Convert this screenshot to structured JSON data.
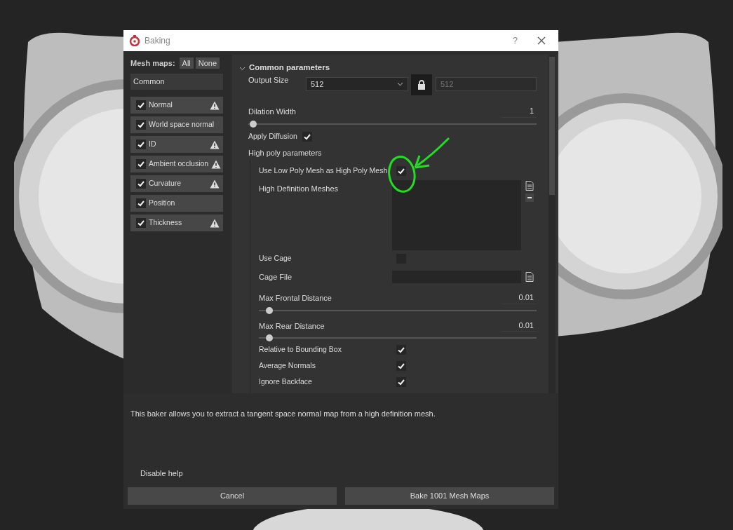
{
  "window": {
    "title": "Baking",
    "help": "?"
  },
  "mesh_maps": {
    "label": "Mesh maps:",
    "buttons": [
      "All",
      "None"
    ],
    "group": "Common",
    "items": [
      {
        "label": "Normal",
        "checked": true,
        "warning": true
      },
      {
        "label": "World space normal",
        "checked": true,
        "warning": false
      },
      {
        "label": "ID",
        "checked": true,
        "warning": true
      },
      {
        "label": "Ambient occlusion",
        "checked": true,
        "warning": true
      },
      {
        "label": "Curvature",
        "checked": true,
        "warning": true
      },
      {
        "label": "Position",
        "checked": true,
        "warning": false
      },
      {
        "label": "Thickness",
        "checked": true,
        "warning": true
      }
    ]
  },
  "section": {
    "title": "Common parameters",
    "expanded": true,
    "params": [
      {
        "kind": "size",
        "label": "Output Size",
        "value": "512",
        "locked": true,
        "linked_value": "512"
      },
      {
        "kind": "slider",
        "label": "Dilation Width",
        "reading": "1",
        "level": 0
      },
      {
        "kind": "checkbox",
        "label": "Apply Diffusion",
        "checked": true
      },
      {
        "kind": "group",
        "label": "High poly parameters",
        "children": [
          {
            "kind": "checkbox",
            "label": "Use Low Poly Mesh as High Poly Mesh",
            "checked": true
          },
          {
            "kind": "list",
            "label": "High Definition Meshes"
          },
          {
            "kind": "checkbox",
            "label": "Use Cage",
            "checked": false
          },
          {
            "kind": "file",
            "label": "Cage File"
          },
          {
            "kind": "slider",
            "label": "Max Frontal Distance",
            "reading": "0.01",
            "level": 0.02
          },
          {
            "kind": "slider",
            "label": "Max Rear Distance",
            "reading": "0.01",
            "level": 0.02
          },
          {
            "kind": "checkbox",
            "label": "Relative to Bounding Box",
            "checked": true
          },
          {
            "kind": "checkbox",
            "label": "Average Normals",
            "checked": true
          },
          {
            "kind": "checkbox",
            "label": "Ignore Backface",
            "checked": true
          }
        ]
      }
    ]
  },
  "help_text": "This baker allows you to extract a tangent space normal map from a high definition mesh.",
  "disable_help": "Disable help",
  "buttons": [
    "Cancel",
    "Bake 1001 Mesh Maps"
  ]
}
